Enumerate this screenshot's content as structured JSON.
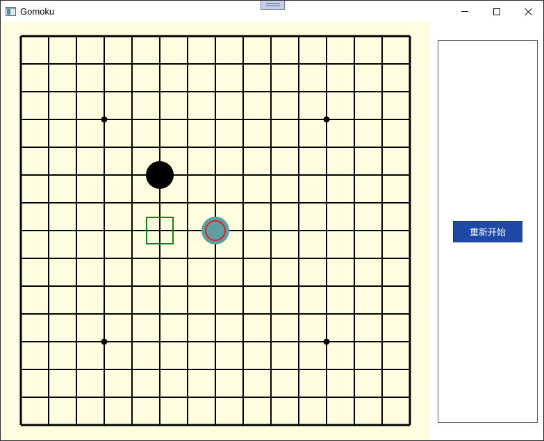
{
  "window": {
    "title": "Gomoku",
    "icon": "app-window-icon",
    "controls": [
      "minimize-icon",
      "maximize-icon",
      "close-icon"
    ]
  },
  "board": {
    "size": 15,
    "background": "#fffde0",
    "grid_color": "#000000",
    "star_points": [
      [
        3,
        3
      ],
      [
        11,
        3
      ],
      [
        3,
        11
      ],
      [
        11,
        11
      ]
    ],
    "stones": [
      {
        "col": 5,
        "row": 5,
        "color": "black"
      }
    ],
    "cursor_marker": {
      "col": 5,
      "row": 7,
      "color": "#1a7a1a"
    },
    "last_move_marker": {
      "col": 7,
      "row": 7,
      "fill": "#5f9ea0",
      "ring": "#e02020"
    }
  },
  "side_panel": {
    "restart_label": "重新开始",
    "button_color": "#1e4aa6"
  }
}
